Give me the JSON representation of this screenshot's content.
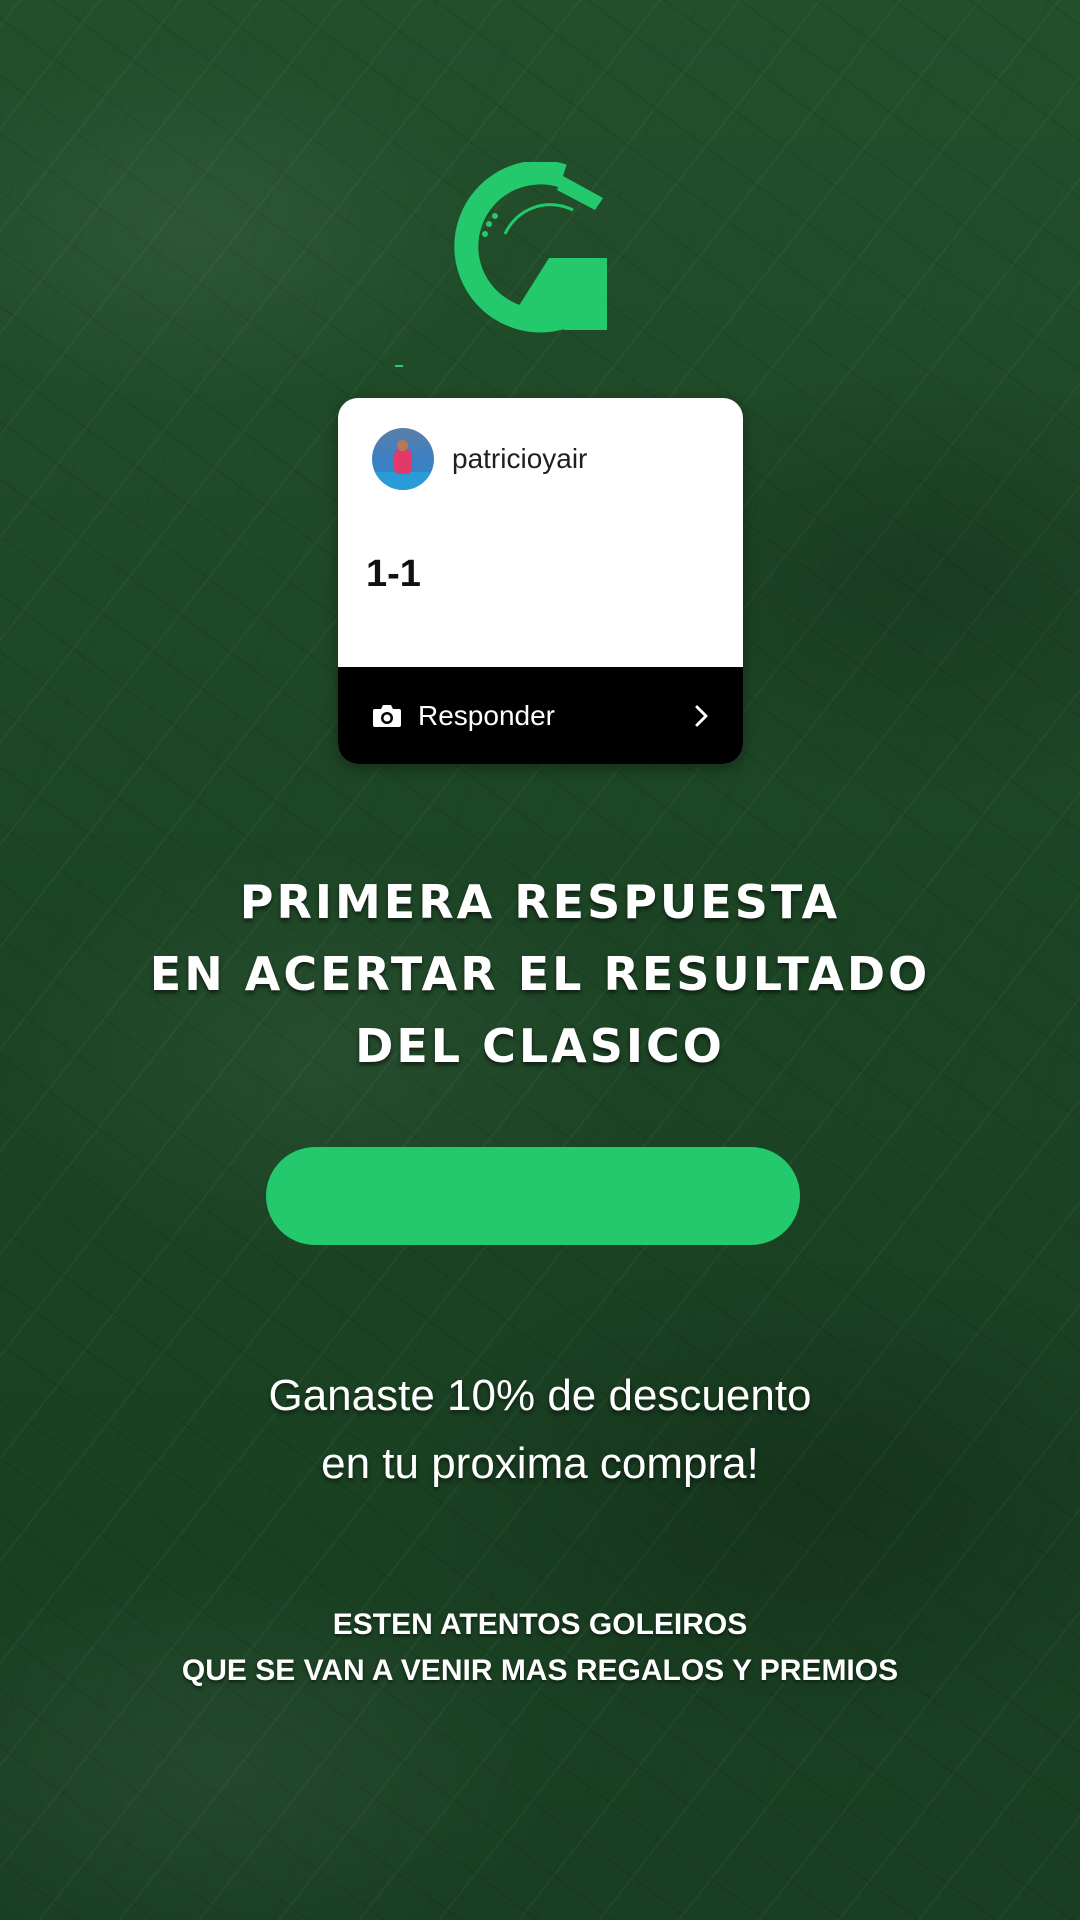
{
  "colors": {
    "background": "#1f4a28",
    "brand_green": "#23c96c",
    "card_bg": "#ffffff",
    "reply_bar_bg": "#000000",
    "text_light": "#ffffff"
  },
  "brand": {
    "logo_icon": "g-logo-icon"
  },
  "story_reply_card": {
    "username": "patricioyair",
    "avatar_icon": "avatar-image",
    "reply_text": "1-1",
    "reply_bar": {
      "camera_icon": "camera-icon",
      "label": "Responder",
      "chevron_icon": "chevron-right-icon"
    }
  },
  "headline": {
    "lines": [
      "PRIMERA RESPUESTA",
      "EN ACERTAR EL RESULTADO",
      "DEL CLASICO"
    ]
  },
  "cta_button": {
    "label": ""
  },
  "discount_message": {
    "lines": [
      "Ganaste 10% de descuento",
      "en tu proxima compra!"
    ]
  },
  "footer_note": {
    "lines": [
      "ESTEN ATENTOS GOLEIROS",
      "QUE SE VAN A VENIR MAS REGALOS Y PREMIOS"
    ]
  }
}
